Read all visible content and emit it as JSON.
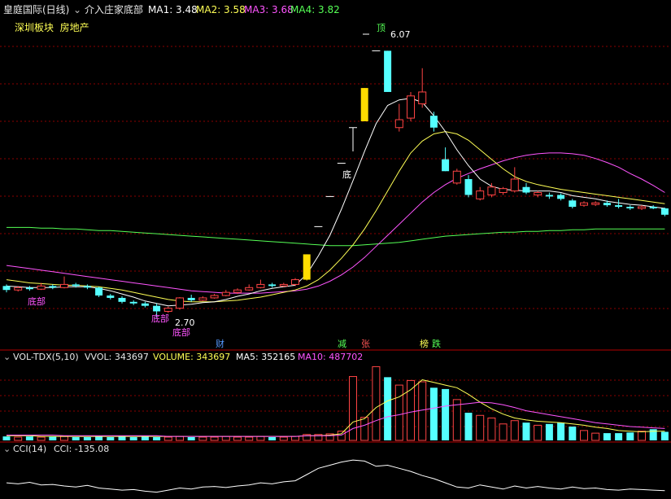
{
  "header": {
    "stock_label": "皇庭国际(日线)",
    "indicator_label": "介入庄家底部",
    "ma": [
      {
        "label": "MA1: 3.48",
        "color": "#ffffff"
      },
      {
        "label": "MA2: 3.58",
        "color": "#ffff55"
      },
      {
        "label": "MA3: 3.68",
        "color": "#ff55ff"
      },
      {
        "label": "MA4: 3.82",
        "color": "#55ff55"
      }
    ],
    "sector": "深圳板块  房地产"
  },
  "price_panel": {
    "annotations": {
      "high_mark": "顶",
      "high_value": "6.07",
      "low_value": "2.70",
      "bottom_mark": "底",
      "bottom_label": "底部",
      "bottom_label_left": "底部",
      "bottom_label_left2": "底部"
    },
    "event_labels": [
      {
        "text": "财",
        "color": "#5599ff"
      },
      {
        "text": "减",
        "color": "#55ff55"
      },
      {
        "text": "张",
        "color": "#ff5555"
      },
      {
        "text": "榜",
        "color": "#ffff55"
      },
      {
        "text": "跌",
        "color": "#55ff55"
      }
    ]
  },
  "vol_panel": {
    "title": "VOL-TDX(5,10)",
    "vvol": "VVOL: 343697",
    "volume": "VOLUME: 343697",
    "ma5": "MA5: 352165",
    "ma10": "MA10: 487702"
  },
  "cci_panel": {
    "title": "CCI(14)",
    "value": "CCI: -135.08"
  },
  "colors": {
    "up": "#ff4444",
    "down": "#55ffff",
    "signal": "#ffdd00",
    "ma1": "#ffffff",
    "ma2": "#ffff55",
    "ma3": "#ff55ff",
    "ma4": "#55ff55",
    "grid": "#8b0000"
  },
  "chart_data": {
    "type": "candlestick",
    "ylim": [
      2.6,
      6.3
    ],
    "candles": [
      {
        "o": 3.1,
        "c": 3.05,
        "h": 3.12,
        "l": 3.02
      },
      {
        "o": 3.05,
        "c": 3.08,
        "h": 3.1,
        "l": 3.03
      },
      {
        "o": 3.08,
        "c": 3.06,
        "h": 3.1,
        "l": 3.04
      },
      {
        "o": 3.06,
        "c": 3.1,
        "h": 3.14,
        "l": 3.05
      },
      {
        "o": 3.1,
        "c": 3.08,
        "h": 3.12,
        "l": 3.06
      },
      {
        "o": 3.08,
        "c": 3.12,
        "h": 3.22,
        "l": 3.07
      },
      {
        "o": 3.12,
        "c": 3.1,
        "h": 3.14,
        "l": 3.08
      },
      {
        "o": 3.1,
        "c": 3.08,
        "h": 3.12,
        "l": 3.06
      },
      {
        "o": 3.08,
        "c": 2.98,
        "h": 3.09,
        "l": 2.96
      },
      {
        "o": 2.98,
        "c": 2.95,
        "h": 3.0,
        "l": 2.93
      },
      {
        "o": 2.95,
        "c": 2.9,
        "h": 2.97,
        "l": 2.88
      },
      {
        "o": 2.9,
        "c": 2.88,
        "h": 2.92,
        "l": 2.86
      },
      {
        "o": 2.88,
        "c": 2.85,
        "h": 2.9,
        "l": 2.83
      },
      {
        "o": 2.85,
        "c": 2.78,
        "h": 2.88,
        "l": 2.7
      },
      {
        "o": 2.78,
        "c": 2.82,
        "h": 2.84,
        "l": 2.76
      },
      {
        "o": 2.82,
        "c": 2.95,
        "h": 2.96,
        "l": 2.8
      },
      {
        "o": 2.95,
        "c": 2.92,
        "h": 2.99,
        "l": 2.9
      },
      {
        "o": 2.92,
        "c": 2.95,
        "h": 2.97,
        "l": 2.91
      },
      {
        "o": 2.95,
        "c": 2.98,
        "h": 3.0,
        "l": 2.94
      },
      {
        "o": 2.98,
        "c": 3.02,
        "h": 3.05,
        "l": 2.97
      },
      {
        "o": 3.02,
        "c": 3.05,
        "h": 3.07,
        "l": 3.0
      },
      {
        "o": 3.05,
        "c": 3.08,
        "h": 3.12,
        "l": 3.04
      },
      {
        "o": 3.08,
        "c": 3.12,
        "h": 3.18,
        "l": 3.07
      },
      {
        "o": 3.12,
        "c": 3.1,
        "h": 3.14,
        "l": 3.08
      },
      {
        "o": 3.1,
        "c": 3.12,
        "h": 3.14,
        "l": 3.09
      },
      {
        "o": 3.12,
        "c": 3.18,
        "h": 3.2,
        "l": 3.1
      },
      {
        "o": 3.18,
        "c": 3.5,
        "h": 3.5,
        "l": 3.17,
        "sig": true
      },
      {
        "o": 3.85,
        "c": 3.85,
        "h": 3.85,
        "l": 3.85,
        "flat": true
      },
      {
        "o": 4.23,
        "c": 4.23,
        "h": 4.23,
        "l": 4.23,
        "flat": true
      },
      {
        "o": 4.65,
        "c": 4.65,
        "h": 4.65,
        "l": 4.65,
        "flat": true
      },
      {
        "o": 5.1,
        "c": 5.1,
        "h": 5.1,
        "l": 4.8,
        "flat": true
      },
      {
        "o": 5.18,
        "c": 5.6,
        "h": 5.6,
        "l": 5.18,
        "sig": true
      },
      {
        "o": 6.07,
        "c": 6.07,
        "h": 6.07,
        "l": 6.07,
        "flat": true
      },
      {
        "o": 6.07,
        "c": 5.55,
        "h": 6.07,
        "l": 5.55
      },
      {
        "o": 5.1,
        "c": 5.2,
        "h": 5.4,
        "l": 5.05
      },
      {
        "o": 5.22,
        "c": 5.5,
        "h": 5.55,
        "l": 5.18
      },
      {
        "o": 5.4,
        "c": 5.55,
        "h": 5.85,
        "l": 5.35
      },
      {
        "o": 5.25,
        "c": 5.1,
        "h": 5.3,
        "l": 5.05
      },
      {
        "o": 4.7,
        "c": 4.55,
        "h": 4.85,
        "l": 4.55
      },
      {
        "o": 4.4,
        "c": 4.55,
        "h": 4.58,
        "l": 4.38
      },
      {
        "o": 4.45,
        "c": 4.25,
        "h": 4.5,
        "l": 4.22
      },
      {
        "o": 4.2,
        "c": 4.3,
        "h": 4.35,
        "l": 4.18
      },
      {
        "o": 4.25,
        "c": 4.35,
        "h": 4.4,
        "l": 4.22
      },
      {
        "o": 4.28,
        "c": 4.33,
        "h": 4.35,
        "l": 4.25
      },
      {
        "o": 4.3,
        "c": 4.45,
        "h": 4.6,
        "l": 4.28
      },
      {
        "o": 4.35,
        "c": 4.28,
        "h": 4.4,
        "l": 4.26
      },
      {
        "o": 4.25,
        "c": 4.28,
        "h": 4.3,
        "l": 4.22
      },
      {
        "o": 4.25,
        "c": 4.23,
        "h": 4.28,
        "l": 4.2
      },
      {
        "o": 4.25,
        "c": 4.2,
        "h": 4.27,
        "l": 4.18
      },
      {
        "o": 4.18,
        "c": 4.1,
        "h": 4.2,
        "l": 4.08
      },
      {
        "o": 4.12,
        "c": 4.15,
        "h": 4.17,
        "l": 4.1
      },
      {
        "o": 4.13,
        "c": 4.15,
        "h": 4.17,
        "l": 4.11
      },
      {
        "o": 4.15,
        "c": 4.12,
        "h": 4.18,
        "l": 4.1
      },
      {
        "o": 4.12,
        "c": 4.1,
        "h": 4.2,
        "l": 4.08
      },
      {
        "o": 4.1,
        "c": 4.08,
        "h": 4.12,
        "l": 4.06
      },
      {
        "o": 4.08,
        "c": 4.1,
        "h": 4.12,
        "l": 4.06
      },
      {
        "o": 4.1,
        "c": 4.08,
        "h": 4.12,
        "l": 4.07
      },
      {
        "o": 4.08,
        "c": 4.0,
        "h": 4.09,
        "l": 3.98
      }
    ],
    "ma1": [
      3.1,
      3.09,
      3.08,
      3.08,
      3.08,
      3.09,
      3.09,
      3.09,
      3.07,
      3.04,
      3.0,
      2.96,
      2.91,
      2.88,
      2.85,
      2.86,
      2.87,
      2.89,
      2.9,
      2.93,
      2.97,
      3.0,
      3.04,
      3.07,
      3.09,
      3.11,
      3.25,
      3.48,
      3.74,
      4.07,
      4.43,
      4.8,
      5.15,
      5.38,
      5.45,
      5.47,
      5.42,
      5.25,
      5.05,
      4.82,
      4.62,
      4.45,
      4.36,
      4.32,
      4.31,
      4.3,
      4.3,
      4.3,
      4.28,
      4.24,
      4.22,
      4.2,
      4.17,
      4.15,
      4.13,
      4.12,
      4.1,
      4.08
    ],
    "ma2": [
      3.18,
      3.16,
      3.14,
      3.13,
      3.12,
      3.11,
      3.11,
      3.1,
      3.09,
      3.07,
      3.05,
      3.02,
      2.99,
      2.96,
      2.93,
      2.91,
      2.9,
      2.9,
      2.9,
      2.91,
      2.92,
      2.94,
      2.96,
      2.99,
      3.02,
      3.05,
      3.1,
      3.18,
      3.3,
      3.45,
      3.62,
      3.82,
      4.05,
      4.3,
      4.55,
      4.78,
      4.93,
      5.02,
      5.05,
      5.02,
      4.94,
      4.82,
      4.7,
      4.58,
      4.48,
      4.42,
      4.38,
      4.35,
      4.32,
      4.3,
      4.28,
      4.26,
      4.24,
      4.22,
      4.2,
      4.18,
      4.16,
      4.14
    ],
    "ma3": [
      3.36,
      3.34,
      3.32,
      3.3,
      3.28,
      3.26,
      3.24,
      3.22,
      3.2,
      3.18,
      3.16,
      3.14,
      3.12,
      3.1,
      3.08,
      3.06,
      3.04,
      3.03,
      3.02,
      3.01,
      3.01,
      3.01,
      3.01,
      3.02,
      3.03,
      3.04,
      3.06,
      3.1,
      3.16,
      3.24,
      3.34,
      3.46,
      3.6,
      3.74,
      3.88,
      4.02,
      4.16,
      4.28,
      4.38,
      4.46,
      4.52,
      4.58,
      4.63,
      4.68,
      4.72,
      4.75,
      4.77,
      4.78,
      4.78,
      4.77,
      4.75,
      4.71,
      4.66,
      4.6,
      4.52,
      4.45,
      4.37,
      4.28
    ],
    "ma4": [
      3.84,
      3.84,
      3.84,
      3.83,
      3.83,
      3.82,
      3.82,
      3.81,
      3.8,
      3.8,
      3.79,
      3.78,
      3.77,
      3.76,
      3.75,
      3.74,
      3.73,
      3.72,
      3.71,
      3.7,
      3.69,
      3.68,
      3.67,
      3.66,
      3.65,
      3.64,
      3.63,
      3.62,
      3.61,
      3.61,
      3.61,
      3.62,
      3.63,
      3.64,
      3.65,
      3.67,
      3.69,
      3.71,
      3.73,
      3.74,
      3.75,
      3.76,
      3.77,
      3.78,
      3.78,
      3.79,
      3.79,
      3.8,
      3.8,
      3.81,
      3.81,
      3.82,
      3.82,
      3.82,
      3.82,
      3.82,
      3.82,
      3.82
    ],
    "volume": [
      6,
      5,
      6,
      5,
      6,
      6,
      5,
      5,
      6,
      5,
      6,
      5,
      6,
      5,
      5,
      6,
      5,
      5,
      5,
      6,
      5,
      5,
      6,
      5,
      5,
      6,
      9,
      9,
      10,
      14,
      97,
      35,
      112,
      96,
      84,
      91,
      89,
      80,
      78,
      62,
      42,
      38,
      34,
      25,
      30,
      27,
      23,
      25,
      27,
      21,
      15,
      11,
      11,
      11,
      12,
      14,
      17,
      13
    ],
    "vol_ma5": [
      7,
      7,
      7,
      6,
      6,
      6,
      6,
      6,
      6,
      6,
      6,
      6,
      6,
      6,
      6,
      6,
      6,
      6,
      6,
      6,
      6,
      6,
      6,
      6,
      6,
      6,
      7,
      7,
      8,
      10,
      28,
      33,
      50,
      60,
      66,
      77,
      92,
      88,
      84,
      80,
      70,
      58,
      48,
      40,
      34,
      31,
      29,
      28,
      27,
      25,
      23,
      20,
      18,
      15,
      14,
      13,
      14,
      14
    ],
    "vol_ma10": [
      8,
      8,
      8,
      8,
      8,
      7,
      7,
      7,
      7,
      7,
      7,
      7,
      7,
      7,
      6,
      6,
      6,
      6,
      6,
      6,
      6,
      6,
      6,
      6,
      6,
      6,
      7,
      7,
      7,
      8,
      18,
      23,
      30,
      36,
      39,
      43,
      46,
      49,
      52,
      54,
      56,
      58,
      57,
      54,
      50,
      45,
      42,
      39,
      36,
      33,
      30,
      27,
      25,
      23,
      21,
      20,
      19,
      18
    ],
    "cci": [
      -60,
      -70,
      -55,
      -80,
      -75,
      -90,
      -100,
      -85,
      -110,
      -120,
      -130,
      -125,
      -140,
      -150,
      -130,
      -110,
      -120,
      -100,
      -95,
      -105,
      -90,
      -80,
      -60,
      -70,
      -50,
      -40,
      20,
      80,
      110,
      140,
      160,
      150,
      100,
      110,
      80,
      50,
      10,
      -20,
      -60,
      -100,
      -110,
      -80,
      -100,
      -120,
      -90,
      -110,
      -95,
      -110,
      -120,
      -100,
      -115,
      -110,
      -125,
      -130,
      -120,
      -125,
      -130,
      -135
    ]
  }
}
